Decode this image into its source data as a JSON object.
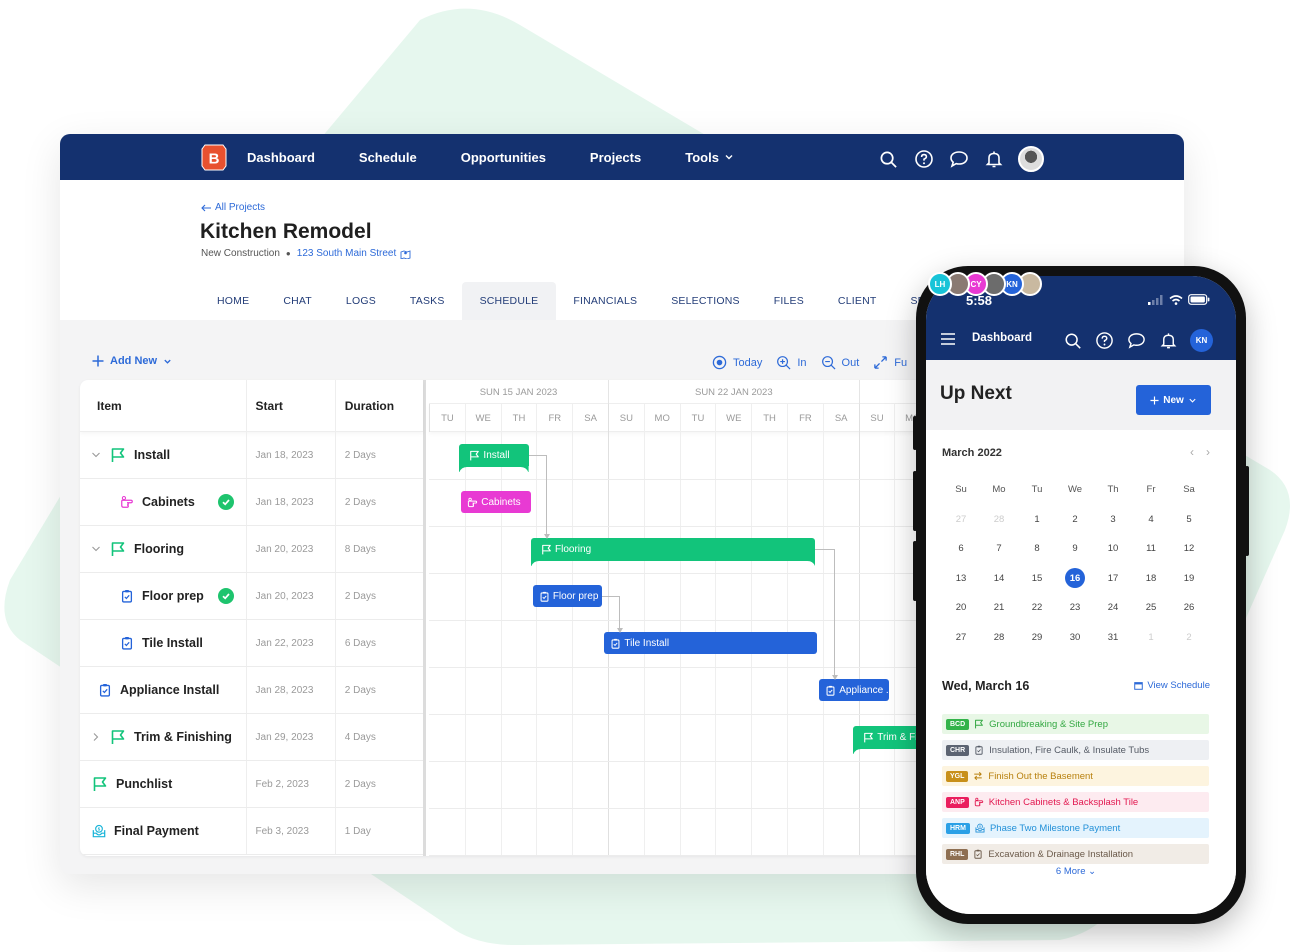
{
  "colors": {
    "nav_bg": "#14316f",
    "accent_blue": "#2463d9",
    "link_blue": "#2d6ad8",
    "green": "#12c47b",
    "pink": "#e83ad3",
    "logo_orange": "#e8512f"
  },
  "topnav": {
    "logo_letter": "B",
    "links": [
      {
        "label": "Dashboard"
      },
      {
        "label": "Schedule"
      },
      {
        "label": "Opportunities"
      },
      {
        "label": "Projects"
      },
      {
        "label": "Tools",
        "dropdown": true
      }
    ],
    "icons": [
      "search-icon",
      "help-icon",
      "chat-icon",
      "bell-icon",
      "user-avatar"
    ]
  },
  "project": {
    "back_label": "All Projects",
    "title": "Kitchen Remodel",
    "type": "New Construction",
    "address": "123 South Main Street",
    "team": [
      {
        "initials": "LH",
        "color": "#18c4d8"
      },
      {
        "initials": "",
        "color": "#8a7a72"
      },
      {
        "initials": "CY",
        "color": "#e83ad3"
      },
      {
        "initials": "",
        "color": "#6c6c6c"
      },
      {
        "initials": "KN",
        "color": "#2463d9"
      },
      {
        "initials": "",
        "color": "#c9b9a0"
      }
    ]
  },
  "tabs": [
    {
      "label": "HOME"
    },
    {
      "label": "CHAT"
    },
    {
      "label": "LOGS"
    },
    {
      "label": "TASKS"
    },
    {
      "label": "SCHEDULE",
      "active": true
    },
    {
      "label": "FINANCIALS"
    },
    {
      "label": "SELECTIONS"
    },
    {
      "label": "FILES"
    },
    {
      "label": "CLIENT"
    },
    {
      "label": "SE"
    }
  ],
  "toolbar": {
    "add_new": "Add New",
    "today": "Today",
    "zoom_in": "In",
    "zoom_out": "Out",
    "fullscreen": "Fu"
  },
  "table": {
    "headers": {
      "item": "Item",
      "start": "Start",
      "duration": "Duration"
    },
    "rows": [
      {
        "name": "Install",
        "icon": "flag-icon",
        "level": 0,
        "expander": "down",
        "start": "Jan 18, 2023",
        "duration": "2 Days",
        "done": false
      },
      {
        "name": "Cabinets",
        "icon": "hand-point-icon",
        "level": 1,
        "expander": null,
        "start": "Jan 18, 2023",
        "duration": "2 Days",
        "done": true
      },
      {
        "name": "Flooring",
        "icon": "flag-icon",
        "level": 0,
        "expander": "down",
        "start": "Jan 20, 2023",
        "duration": "8 Days",
        "done": false
      },
      {
        "name": "Floor prep",
        "icon": "clipboard-check-icon",
        "level": 1,
        "expander": null,
        "start": "Jan 20, 2023",
        "duration": "2 Days",
        "done": true
      },
      {
        "name": "Tile Install",
        "icon": "clipboard-check-icon",
        "level": 1,
        "expander": null,
        "start": "Jan 22, 2023",
        "duration": "6 Days",
        "done": false
      },
      {
        "name": "Appliance Install",
        "icon": "clipboard-check-icon",
        "level": 0.5,
        "expander": null,
        "start": "Jan 28, 2023",
        "duration": "2 Days",
        "done": false
      },
      {
        "name": "Trim & Finishing",
        "icon": "flag-icon",
        "level": 0,
        "expander": "right",
        "start": "Jan 29, 2023",
        "duration": "4 Days",
        "done": false
      },
      {
        "name": "Punchlist",
        "icon": "flag-icon",
        "level": -1,
        "expander": null,
        "start": "Feb 2, 2023",
        "duration": "2 Days",
        "done": false
      },
      {
        "name": "Final Payment",
        "icon": "payment-icon",
        "level": -1,
        "expander": null,
        "start": "Feb 3, 2023",
        "duration": "1 Day",
        "done": false
      }
    ]
  },
  "gantt": {
    "weeks": [
      {
        "label": "SUN 15 JAN 2023"
      },
      {
        "label": "SUN 22 JAN 2023"
      },
      {
        "label": ""
      }
    ],
    "days": [
      "TU",
      "WE",
      "TH",
      "FR",
      "SA",
      "SU",
      "MO",
      "TU",
      "WE",
      "TH",
      "FR",
      "SA",
      "SU",
      "MO"
    ],
    "bars": [
      {
        "label": "Install",
        "row": 0,
        "start_day": 0.85,
        "days": 2,
        "kind": "summary",
        "color": "green",
        "icon": "flag-icon"
      },
      {
        "label": "Cabinets",
        "row": 1,
        "start_day": 0.9,
        "days": 2,
        "kind": "task",
        "color": "pink",
        "icon": "hand-point-icon"
      },
      {
        "label": "Flooring",
        "row": 2,
        "start_day": 2.85,
        "days": 8,
        "kind": "summary",
        "color": "green",
        "icon": "flag-icon"
      },
      {
        "label": "Floor prep",
        "row": 3,
        "start_day": 2.9,
        "days": 2,
        "kind": "task",
        "color": "blue",
        "icon": "clipboard-check-icon"
      },
      {
        "label": "Tile Install",
        "row": 4,
        "start_day": 4.9,
        "days": 6,
        "kind": "task",
        "color": "blue",
        "icon": "clipboard-check-icon"
      },
      {
        "label": "Appliance ..",
        "row": 5,
        "start_day": 10.9,
        "days": 2,
        "kind": "task",
        "color": "blue",
        "icon": "clipboard-check-icon"
      },
      {
        "label": "Trim & Finishing",
        "row": 6,
        "start_day": 11.85,
        "days": 4,
        "kind": "summary",
        "color": "green",
        "icon": "flag-icon"
      }
    ],
    "links": [
      {
        "from": 0,
        "to": 2
      },
      {
        "from": 3,
        "to": 4
      },
      {
        "from": 2,
        "to": 5
      }
    ]
  },
  "phone": {
    "time": "5:58",
    "nav_title": "Dashboard",
    "user_initials": "KN",
    "heading": "Up Next",
    "new_button": "New",
    "calendar": {
      "month_label": "March 2022",
      "dow": [
        "Su",
        "Mo",
        "Tu",
        "We",
        "Th",
        "Fr",
        "Sa"
      ],
      "weeks": [
        [
          "27",
          "28",
          "1",
          "2",
          "3",
          "4",
          "5"
        ],
        [
          "6",
          "7",
          "8",
          "9",
          "10",
          "11",
          "12"
        ],
        [
          "13",
          "14",
          "15",
          "16",
          "17",
          "18",
          "19"
        ],
        [
          "20",
          "21",
          "22",
          "23",
          "24",
          "25",
          "26"
        ],
        [
          "27",
          "28",
          "29",
          "30",
          "31",
          "1",
          "2"
        ]
      ],
      "selected": "16",
      "muted_prev": 2,
      "muted_next": 2
    },
    "day_label": "Wed, March 16",
    "view_schedule": "View Schedule",
    "events": [
      {
        "tag": "BCD",
        "label": "Groundbreaking & Site Prep",
        "icon": "flag-icon",
        "tag_color": "#33b34a",
        "text_color": "#33a842",
        "bg": "#e8f7e6"
      },
      {
        "tag": "CHR",
        "label": "Insulation, Fire Caulk, & Insulate Tubs",
        "icon": "clipboard-icon",
        "tag_color": "#5d6472",
        "text_color": "#555b66",
        "bg": "#eef0f3"
      },
      {
        "tag": "YGL",
        "label": "Finish Out the Basement",
        "icon": "swap-icon",
        "tag_color": "#c8901a",
        "text_color": "#b8800e",
        "bg": "#fdf4df"
      },
      {
        "tag": "ANP",
        "label": "Kitchen Cabinets & Backsplash Tile",
        "icon": "hand-point-icon",
        "tag_color": "#ea1e5e",
        "text_color": "#e2174f",
        "bg": "#fdebf0"
      },
      {
        "tag": "HRM",
        "label": "Phase Two Milestone Payment",
        "icon": "payment-icon",
        "tag_color": "#2aa0e6",
        "text_color": "#2290d8",
        "bg": "#e4f3fd"
      },
      {
        "tag": "RHL",
        "label": "Excavation & Drainage Installation",
        "icon": "clipboard-icon",
        "tag_color": "#8e6f52",
        "text_color": "#6b5a4a",
        "bg": "#f1ece6"
      }
    ],
    "more_label": "6 More"
  }
}
